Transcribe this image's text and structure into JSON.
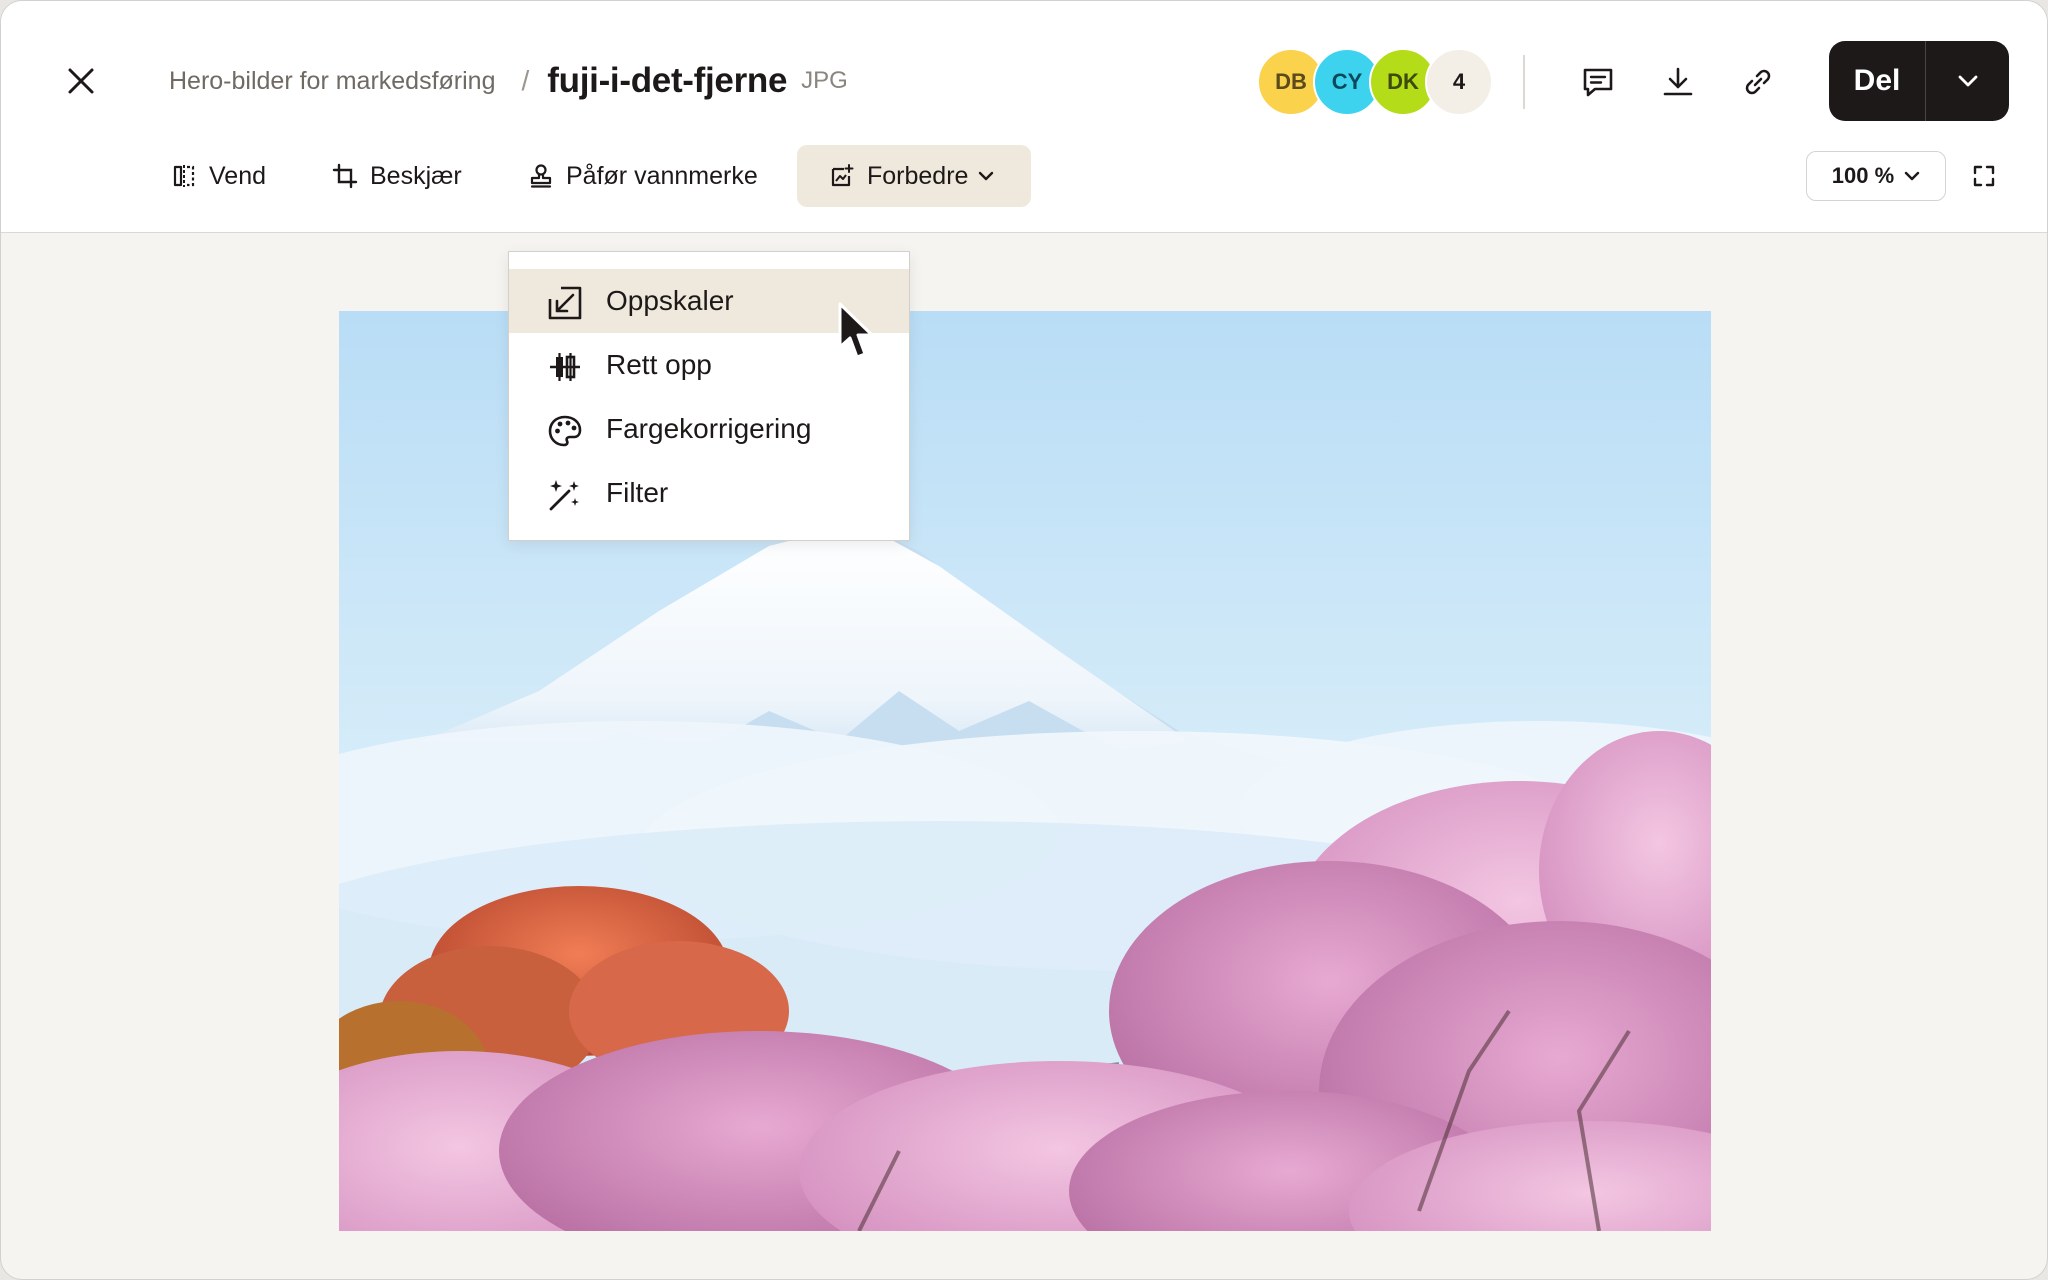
{
  "header": {
    "breadcrumb_folder": "Hero-bilder for markedsføring",
    "breadcrumb_separator": "/",
    "file_name": "fuji-i-det-fjerne",
    "file_ext": "JPG"
  },
  "collaborators": [
    {
      "initials": "DB",
      "color": "#fad24b"
    },
    {
      "initials": "CY",
      "color": "#3dd3ee"
    },
    {
      "initials": "DK",
      "color": "#b4dc19"
    }
  ],
  "collaborators_more": "4",
  "actions": {
    "comment_icon": "comment-icon",
    "download_icon": "download-icon",
    "link_icon": "link-icon",
    "share_label": "Del"
  },
  "toolbar": {
    "flip_label": "Vend",
    "crop_label": "Beskjær",
    "watermark_label": "Påfør vannmerke",
    "enhance_label": "Forbedre",
    "zoom_value": "100 %"
  },
  "enhance_menu": {
    "items": [
      {
        "label": "Oppskaler",
        "icon": "upscale-icon"
      },
      {
        "label": "Rett opp",
        "icon": "straighten-icon"
      },
      {
        "label": "Fargekorrigering",
        "icon": "palette-icon"
      },
      {
        "label": "Filter",
        "icon": "magic-wand-icon"
      }
    ],
    "hovered_index": 0
  },
  "colors": {
    "brand_dark": "#1e1919",
    "active_bg": "#efe8dc",
    "canvas_bg": "#f6f4f0"
  }
}
